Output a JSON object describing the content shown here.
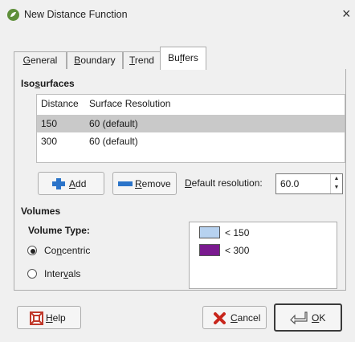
{
  "window": {
    "title": "New Distance Function",
    "close_glyph": "×",
    "icon": "app-leaf-icon"
  },
  "tabs": [
    {
      "prefix": "",
      "mnemonic": "G",
      "suffix": "eneral"
    },
    {
      "prefix": "",
      "mnemonic": "B",
      "suffix": "oundary"
    },
    {
      "prefix": "",
      "mnemonic": "T",
      "suffix": "rend"
    },
    {
      "prefix": "Bu",
      "mnemonic": "f",
      "suffix": "fers",
      "active": true
    }
  ],
  "isosurfaces": {
    "title_prefix": "Iso",
    "title_mnemonic": "s",
    "title_suffix": "urfaces",
    "columns": [
      "Distance",
      "Surface Resolution"
    ],
    "rows": [
      {
        "distance": "150",
        "resolution": "60 (default)",
        "selected": true
      },
      {
        "distance": "300",
        "resolution": "60 (default)",
        "selected": false
      }
    ],
    "add": {
      "mnemonic": "A",
      "suffix": "dd"
    },
    "remove": {
      "mnemonic": "R",
      "suffix": "emove"
    },
    "default_resolution": {
      "mnemonic": "D",
      "suffix": "efault resolution:",
      "value": "60.0"
    }
  },
  "volumes": {
    "title": "Volumes",
    "type_label": "Volume Type:",
    "options": [
      {
        "prefix": "Co",
        "mnemonic": "n",
        "suffix": "centric",
        "checked": true
      },
      {
        "prefix": "Inter",
        "mnemonic": "v",
        "suffix": "als",
        "checked": false
      }
    ],
    "legend": [
      {
        "label": "< 150",
        "color": "#b7d2f0"
      },
      {
        "label": "< 300",
        "color": "#7a1a8f"
      }
    ]
  },
  "footer": {
    "help": {
      "mnemonic": "H",
      "suffix": "elp"
    },
    "cancel": {
      "mnemonic": "C",
      "suffix": "ancel"
    },
    "ok": {
      "mnemonic": "O",
      "suffix": "K"
    }
  }
}
